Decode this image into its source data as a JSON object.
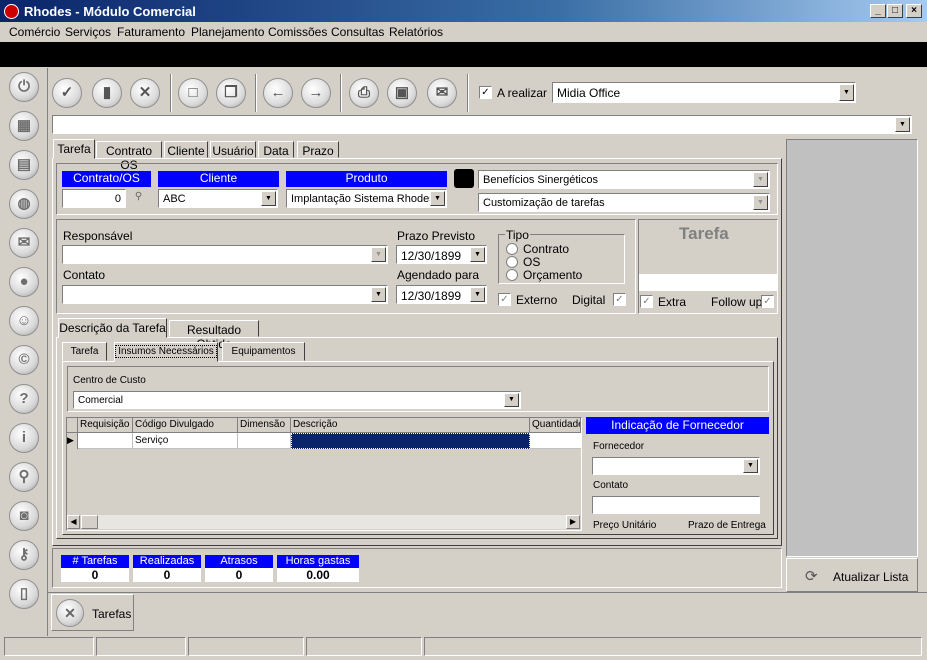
{
  "window": {
    "title": "Rhodes - Módulo Comercial",
    "min": "_",
    "max": "□",
    "close": "×"
  },
  "menu": [
    "Comércio",
    "Serviços",
    "Faturamento",
    "Planejamento",
    "Comissões",
    "Consultas",
    "Relatórios"
  ],
  "toolbar": {
    "a_realizar_label": "A realizar",
    "a_realizar_checked": "✓",
    "company_value": "Midia Office"
  },
  "search": {
    "value": ""
  },
  "tabs": [
    "Tarefa",
    "Contrato OS",
    "Cliente",
    "Usuário",
    "Data",
    "Prazo"
  ],
  "contrato": {
    "label": "Contrato/OS",
    "value": "0"
  },
  "cliente": {
    "label": "Cliente",
    "value": "ABC"
  },
  "produto": {
    "label": "Produto",
    "value": "Implantação Sistema Rhodes"
  },
  "beneficios": "Benefícios Sinergéticos",
  "customizacao": "Customização de tarefas",
  "responsavel": {
    "label": "Responsável",
    "value": ""
  },
  "contato": {
    "label": "Contato",
    "value": ""
  },
  "prazo": {
    "label": "Prazo Previsto",
    "value": "12/30/1899"
  },
  "agendado": {
    "label": "Agendado para",
    "value": "12/30/1899"
  },
  "tipo": {
    "label": "Tipo",
    "options": [
      "Contrato",
      "OS",
      "Orçamento"
    ]
  },
  "externo": {
    "label": "Externo",
    "checked": "✓"
  },
  "digital": {
    "label": "Digital",
    "checked": "✓"
  },
  "tarefa_panel": {
    "title": "Tarefa",
    "extra": "Extra",
    "followup": "Follow up",
    "check": "✓"
  },
  "subtabs": [
    "Descrição da Tarefa",
    "Resultado Obtido"
  ],
  "innertabs": [
    "Tarefa",
    "Insumos Necessários",
    "Equipamentos"
  ],
  "centro": {
    "label": "Centro de Custo",
    "value": "Comercial"
  },
  "grid": {
    "headers": [
      "Requisição",
      "Código Divulgado",
      "Dimensão",
      "Descrição",
      "Quantidade"
    ],
    "row": [
      "",
      "Serviço",
      "",
      "",
      ""
    ]
  },
  "fornecedor": {
    "title": "Indicação de Fornecedor",
    "fornecedor_label": "Fornecedor",
    "contato_label": "Contato",
    "preco_label": "Preço Unitário",
    "prazo_label": "Prazo de Entrega"
  },
  "stats": [
    {
      "label": "# Tarefas",
      "value": "0"
    },
    {
      "label": "Realizadas",
      "value": "0"
    },
    {
      "label": "Atrasos",
      "value": "0"
    },
    {
      "label": "Horas gastas",
      "value": "0.00"
    }
  ],
  "atualizar": "Atualizar Lista",
  "bottom_tab": "Tarefas"
}
